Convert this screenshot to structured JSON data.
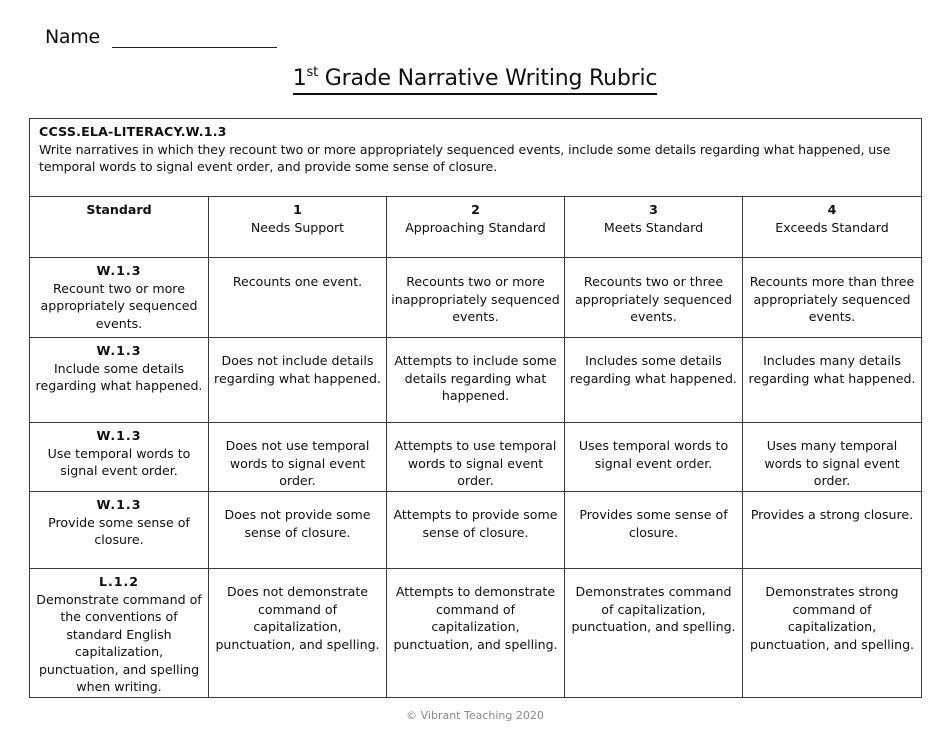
{
  "header": {
    "name_label": "Name",
    "title_prefix": "1",
    "title_superscript": "st",
    "title_rest": " Grade Narrative Writing Rubric"
  },
  "intro": {
    "code": "CCSS.ELA-LITERACY.W.1.3",
    "text": "Write narratives in which they recount two or more appropriately sequenced  events, include some details regarding what happened, use temporal words to signal event order, and provide some  sense  of closure."
  },
  "columns": {
    "standard": "Standard",
    "levels": [
      {
        "number": "1",
        "label": "Needs Support"
      },
      {
        "number": "2",
        "label": "Approaching Standard"
      },
      {
        "number": "3",
        "label": "Meets Standard"
      },
      {
        "number": "4",
        "label": "Exceeds Standard"
      }
    ]
  },
  "rows": [
    {
      "code": "W.1.3",
      "standard": "Recount two or more appropriately sequenced  events.",
      "levels": [
        "Recounts one event.",
        "Recounts two or more inappropriately sequenced  events.",
        "Recounts two or three appropriately sequenced events.",
        "Recounts more than three appropriately sequenced  events."
      ]
    },
    {
      "code": "W.1.3",
      "standard": "Include some details regarding what happened.",
      "levels": [
        "Does not include details regarding what happened.",
        "Attempts  to include some details regarding what happened.",
        "Includes some details regarding what happened.",
        "Includes many details regarding what happened."
      ]
    },
    {
      "code": "W.1.3",
      "standard": "Use temporal words to signal event order.",
      "levels": [
        "Does not use temporal words to signal event order.",
        "Attempts  to use temporal words to signal event order.",
        "Uses temporal words to signal event order.",
        "Uses many temporal words to signal event order."
      ]
    },
    {
      "code": "W.1.3",
      "standard": "Provide some sense of closure.",
      "levels": [
        "Does not provide some sense of closure.",
        "Attempts to provide some  sense  of closure.",
        "Provides some  sense  of closure.",
        "Provides a strong closure."
      ]
    },
    {
      "code": "L.1.2",
      "standard": "Demonstrate  command of the conventions of standard English capitalization, punctuation, and spelling when writing.",
      "levels": [
        "Does not demonstrate command  of capitalization, punctuation, and spelling.",
        "Attempts  to demonstrate  command of capitalization, punctuation, and spelling.",
        "Demonstrates  command of capitalization, punctuation, and spelling.",
        "Demonstrates  strong command  of capitalization, punctuation, and spelling."
      ]
    }
  ],
  "footer": {
    "copyright": "© Vibrant Teaching 2020"
  }
}
